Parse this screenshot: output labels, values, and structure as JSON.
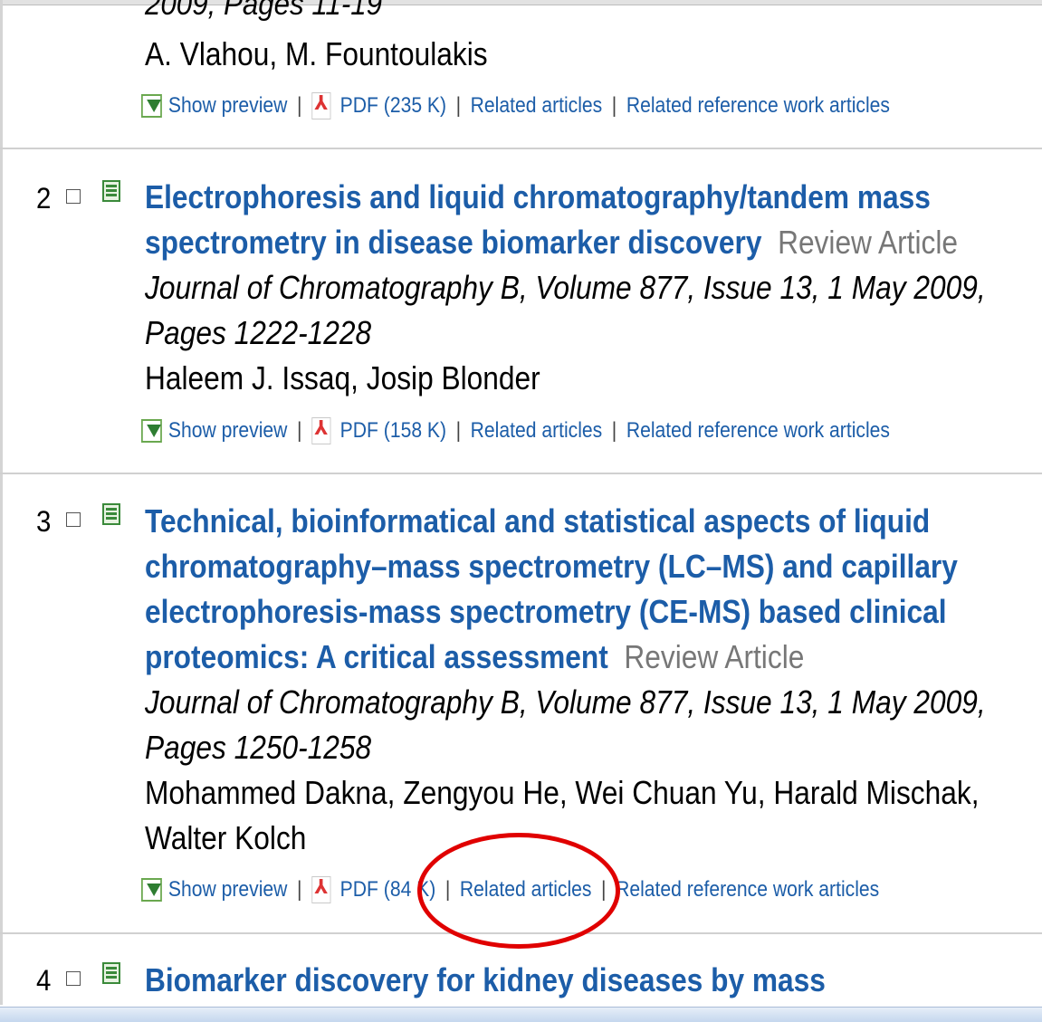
{
  "top_fragment": {
    "journal_tail": "2009, Pages 11-19",
    "authors": "A. Vlahou, M. Fountoulakis",
    "links": {
      "show_preview": "Show preview",
      "pdf": "PDF (235 K)",
      "related_articles": "Related articles",
      "related_reference": "Related reference work articles"
    }
  },
  "results": [
    {
      "number": "2",
      "title_lines": [
        "Electrophoresis and liquid chromatography/tandem mass",
        "spectrometry in disease biomarker discovery"
      ],
      "article_type": "Review Article",
      "journal": "Journal of Chromatography B",
      "volume_line": ", Volume 877, Issue 13, 1 May 2009,",
      "pages": "Pages 1222-1228",
      "authors_lines": [
        "Haleem J. Issaq, Josip Blonder"
      ],
      "links": {
        "show_preview": "Show preview",
        "pdf": "PDF (158 K)",
        "related_articles": "Related articles",
        "related_reference": "Related reference work articles"
      }
    },
    {
      "number": "3",
      "title_lines": [
        "Technical, bioinformatical and statistical aspects of liquid",
        "chromatography–mass spectrometry (LC–MS) and capillary",
        "electrophoresis-mass spectrometry (CE-MS) based clinical",
        "proteomics: A critical assessment"
      ],
      "article_type": "Review Article",
      "journal": "Journal of Chromatography B",
      "volume_line": ", Volume 877, Issue 13, 1 May 2009,",
      "pages": "Pages 1250-1258",
      "authors_lines": [
        "Mohammed Dakna, Zengyou He, Wei Chuan Yu, Harald Mischak,",
        "Walter Kolch"
      ],
      "links": {
        "show_preview": "Show preview",
        "pdf": "PDF (84 K)",
        "related_articles": "Related articles",
        "related_reference": "Related reference work articles"
      }
    },
    {
      "number": "4",
      "title_lines": [
        "Biomarker discovery for kidney diseases by mass"
      ]
    }
  ],
  "colors": {
    "link_blue": "#1c5da8",
    "annotation_red": "#e00000",
    "type_gray": "#777777"
  }
}
